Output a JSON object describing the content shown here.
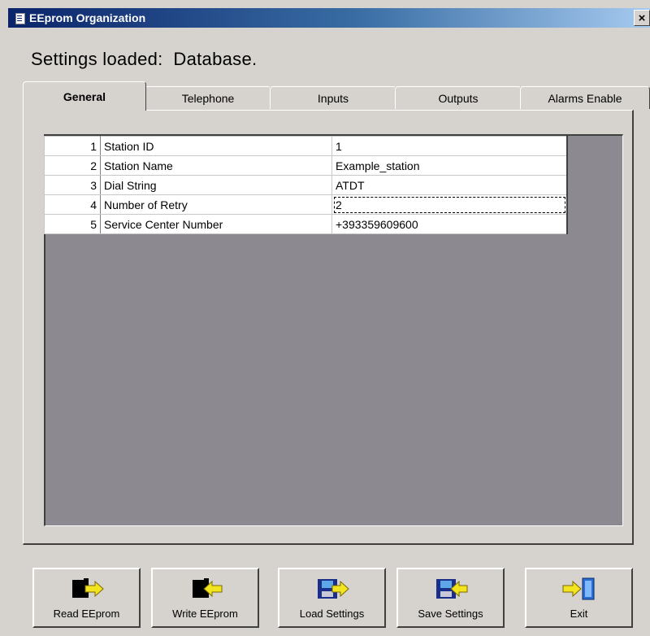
{
  "window": {
    "title": "EEprom Organization",
    "close_label": "×"
  },
  "status": {
    "text": "Settings loaded:  Database."
  },
  "tabs": [
    {
      "label": "General"
    },
    {
      "label": "Telephone"
    },
    {
      "label": "Inputs"
    },
    {
      "label": "Outputs"
    },
    {
      "label": "Alarms Enable"
    }
  ],
  "grid": {
    "rows": [
      {
        "num": "1",
        "name": "Station ID",
        "value": "1"
      },
      {
        "num": "2",
        "name": "Station Name",
        "value": "Example_station"
      },
      {
        "num": "3",
        "name": "Dial String",
        "value": "ATDT"
      },
      {
        "num": "4",
        "name": "Number of Retry",
        "value": "2"
      },
      {
        "num": "5",
        "name": "Service Center Number",
        "value": "+393359609600"
      }
    ]
  },
  "buttons": {
    "read": "Read EEprom",
    "write": "Write EEprom",
    "load": "Load Settings",
    "save": "Save Settings",
    "exit": "Exit"
  },
  "icons": {
    "read": "chip-arrow-right-icon",
    "write": "chip-arrow-left-icon",
    "load": "disk-arrow-right-icon",
    "save": "disk-arrow-left-icon",
    "exit": "door-exit-icon"
  },
  "colors": {
    "title_bar": "#0a246a",
    "panel_background": "#d6d3ce",
    "grid_background": "#8c8a90",
    "arrow_yellow": "#f2e41e"
  }
}
